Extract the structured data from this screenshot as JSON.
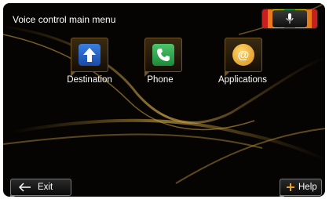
{
  "header": {
    "title": "Voice control main menu"
  },
  "menu": {
    "items": [
      {
        "label": "Destination",
        "icon": "navigation-arrow-icon",
        "color": "#1f5fc8"
      },
      {
        "label": "Phone",
        "icon": "phone-icon",
        "color": "#2aa84a"
      },
      {
        "label": "Applications",
        "icon": "at-sign-icon",
        "color": "#e8a21e"
      }
    ]
  },
  "status": {
    "mic_icon": "microphone-icon",
    "level_colors": [
      "#c81e1e",
      "#e87a1a",
      "#e8d21a",
      "#2aa84a"
    ]
  },
  "footer": {
    "exit_label": "Exit",
    "help_label": "Help",
    "help_accent": "#e8a21e"
  }
}
